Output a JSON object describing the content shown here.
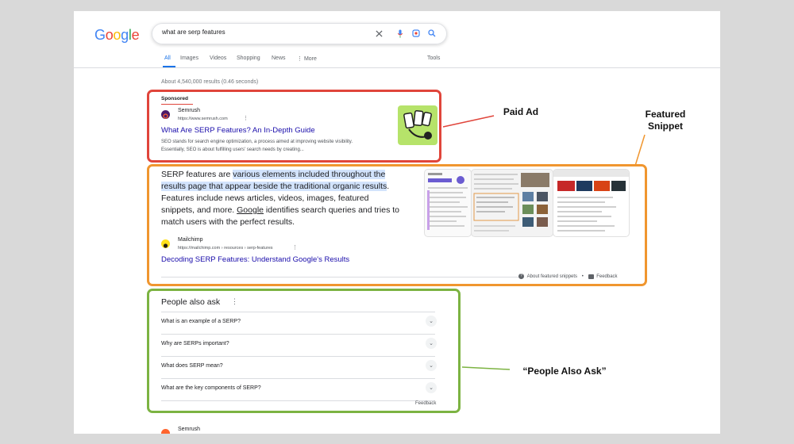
{
  "search": {
    "logo": "Google",
    "query": "what are serp features",
    "tabs": [
      "All",
      "Images",
      "Videos",
      "Shopping",
      "News",
      "More"
    ],
    "tools": "Tools",
    "stats": "About 4,540,000 results (0.46 seconds)"
  },
  "ad": {
    "sponsored": "Sponsored",
    "site": "Semrush",
    "url": "https://www.semrush.com",
    "title": "What Are SERP Features? An In-Depth Guide",
    "snippet": "SEO stands for search engine optimization, a process aimed at improving website visibility. Essentially, SEO is about fulfilling users' search needs by creating..."
  },
  "featured": {
    "text_parts": [
      "SERP features are ",
      "various elements included throughout the results page that appear beside the traditional organic results",
      ". Features include news articles, videos, images, featured snippets, and more. ",
      "Google",
      " identifies search queries and tries to match users with the perfect results."
    ],
    "site": "Mailchimp",
    "url": "https://mailchimp.com › resources › serp-features",
    "title": "Decoding SERP Features: Understand Google's Results",
    "about": "About featured snippets",
    "feedback": "Feedback"
  },
  "paa": {
    "title": "People also ask",
    "questions": [
      "What is an example of a SERP?",
      "Why are SERPs important?",
      "What does SERP mean?",
      "What are the key components of SERP?"
    ],
    "feedback": "Feedback"
  },
  "bottom_site": "Semrush",
  "annotations": {
    "paid_ad": "Paid Ad",
    "featured_snippet": "Featured Snippet",
    "people_also_ask": "“People Also Ask”"
  },
  "colors": {
    "ad_border": "#e0453b",
    "featured_border": "#f0962f",
    "paa_border": "#7cb342",
    "link": "#1a0dab",
    "highlight": "#d2e3fc"
  }
}
